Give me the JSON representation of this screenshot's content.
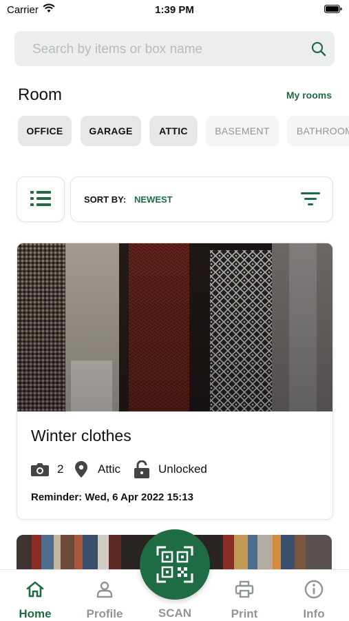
{
  "status_bar": {
    "carrier": "Carrier",
    "time": "1:39 PM"
  },
  "search": {
    "placeholder": "Search by items or box name",
    "value": ""
  },
  "room_section": {
    "title": "Room",
    "my_rooms_link": "My rooms",
    "chips": [
      {
        "label": "OFFICE",
        "state": "active"
      },
      {
        "label": "GARAGE",
        "state": "active"
      },
      {
        "label": "ATTIC",
        "state": "active"
      },
      {
        "label": "BASEMENT",
        "state": "inactive"
      },
      {
        "label": "BATHROOM",
        "state": "inactive"
      }
    ]
  },
  "toolbar": {
    "view_icon": "list-icon",
    "sort_label": "SORT BY:",
    "sort_value": "NEWEST",
    "filter_icon": "filter-icon"
  },
  "boxes": [
    {
      "title": "Winter clothes",
      "photo_count": "2",
      "location": "Attic",
      "lock_status": "Unlocked",
      "reminder": "Reminder: Wed, 6 Apr 2022 15:13"
    }
  ],
  "tab_bar": {
    "tabs": [
      {
        "label": "Home",
        "icon": "home-icon",
        "active": true
      },
      {
        "label": "Profile",
        "icon": "person-icon",
        "active": false
      },
      {
        "label": "SCAN",
        "icon": "qr-code-icon",
        "active": false
      },
      {
        "label": "Print",
        "icon": "printer-icon",
        "active": false
      },
      {
        "label": "Info",
        "icon": "info-icon",
        "active": false
      }
    ]
  },
  "colors": {
    "accent": "#1f6b44",
    "chip_active_bg": "#e6e8e7",
    "inactive_text": "#8f9592"
  }
}
